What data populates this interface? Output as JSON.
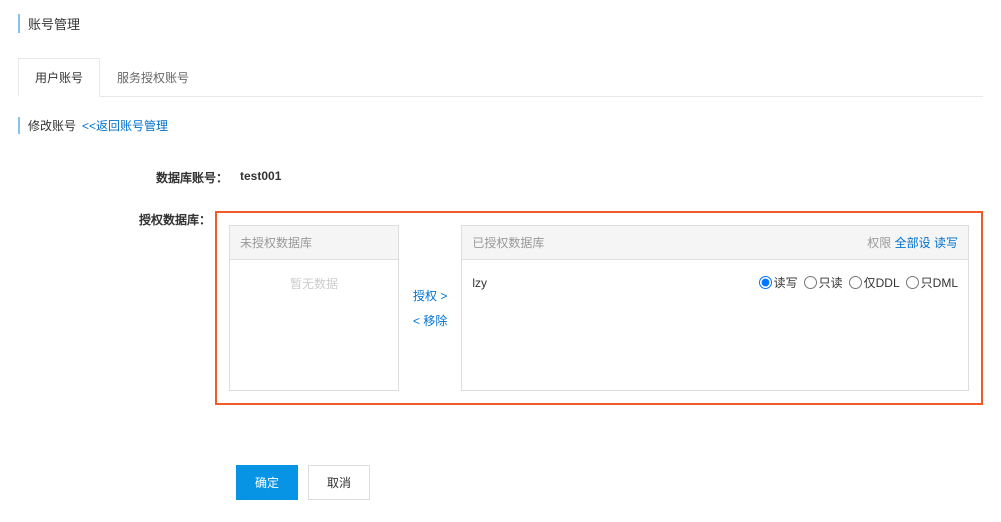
{
  "page": {
    "title": "账号管理"
  },
  "tabs": {
    "user_account": "用户账号",
    "service_auth_account": "服务授权账号"
  },
  "sub_header": {
    "title": "修改账号",
    "back_link": "<<返回账号管理"
  },
  "form": {
    "db_account_label": "数据库账号：",
    "db_account_value": "test001",
    "auth_db_label": "授权数据库："
  },
  "left_panel": {
    "header": "未授权数据库",
    "empty": "暂无数据"
  },
  "transfer": {
    "authorize": "授权 >",
    "remove": "< 移除"
  },
  "right_panel": {
    "header": "已授权数据库",
    "perm_label": "权限",
    "set_all_link": "全部设 读写"
  },
  "db_rows": [
    {
      "name": "lzy",
      "selected": "rw",
      "options": {
        "rw": "读写",
        "ro": "只读",
        "ddl": "仅DDL",
        "dml": "只DML"
      }
    }
  ],
  "buttons": {
    "ok": "确定",
    "cancel": "取消"
  }
}
